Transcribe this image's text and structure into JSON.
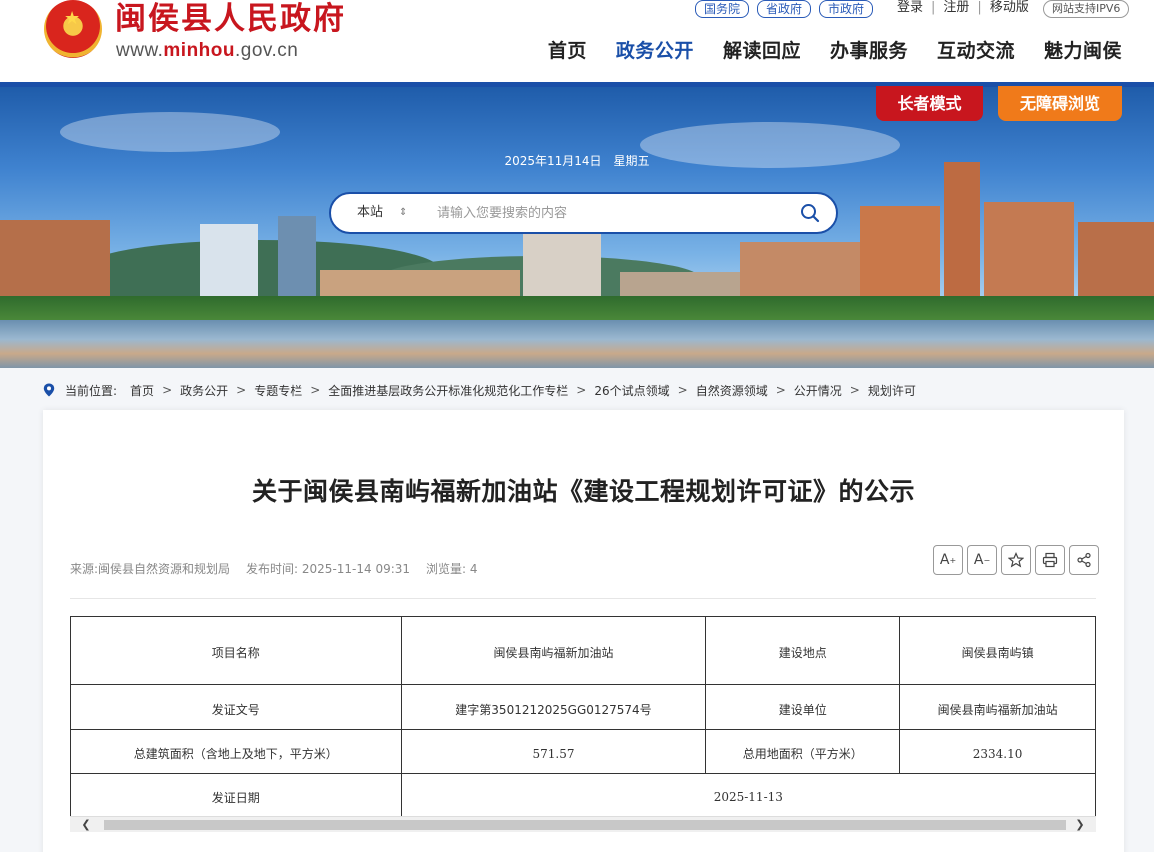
{
  "header": {
    "site_name": "闽侯县人民政府",
    "url_prefix": "www.",
    "url_brand": "minhou",
    "url_suffix": ".gov.cn",
    "gov_links": [
      "国务院",
      "省政府",
      "市政府"
    ],
    "login": "登录",
    "register": "注册",
    "mobile": "移动版",
    "ipv6": "网站支持IPV6",
    "nav": [
      {
        "label": "首页"
      },
      {
        "label": "政务公开"
      },
      {
        "label": "解读回应"
      },
      {
        "label": "办事服务"
      },
      {
        "label": "互动交流"
      },
      {
        "label": "魅力闽侯"
      }
    ],
    "active_nav": "政务公开"
  },
  "banner": {
    "elder_mode": "长者模式",
    "accessible": "无障碍浏览",
    "date": "2025年11月14日",
    "weekday": "星期五",
    "search_scope": "本站",
    "search_placeholder": "请输入您要搜索的内容"
  },
  "breadcrumb": {
    "label": "当前位置:",
    "items": [
      "首页",
      "政务公开",
      "专题专栏",
      "全面推进基层政务公开标准化规范化工作专栏",
      "26个试点领域",
      "自然资源领域",
      "公开情况",
      "规划许可"
    ]
  },
  "article": {
    "title": "关于闽侯县南屿福新加油站《建设工程规划许可证》的公示",
    "source": "来源:闽侯县自然资源和规划局",
    "publish_time": "发布时间: 2025-11-14 09:31",
    "views": "浏览量:  4",
    "table": {
      "project_name_label": "项目名称",
      "project_name": "闽侯县南屿福新加油站",
      "location_label": "建设地点",
      "location": "闽侯县南屿镇",
      "permit_no_label": "发证文号",
      "permit_no": "建字第3501212025GG0127574号",
      "builder_label": "建设单位",
      "builder": "闽侯县南屿福新加油站",
      "total_area_label": "总建筑面积（含地上及地下，平方米）",
      "total_area": "571.57",
      "land_area_label": "总用地面积（平方米）",
      "land_area": "2334.10",
      "issue_date_label": "发证日期",
      "issue_date": "2025-11-13"
    }
  },
  "colors": {
    "brand_red": "#c8161e",
    "nav_blue": "#1a4fa8",
    "accessible_orange": "#f07a1a"
  }
}
